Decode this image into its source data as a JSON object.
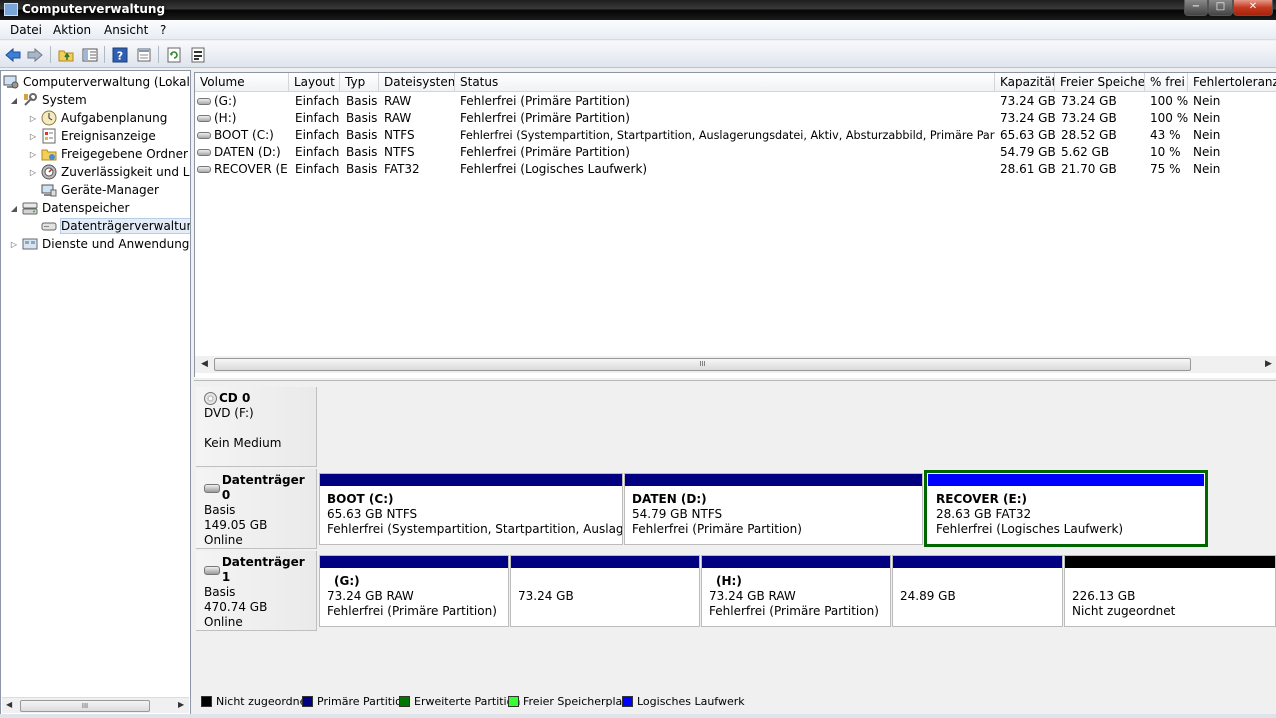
{
  "window": {
    "title": "Computerverwaltung",
    "min": "−",
    "max": "□",
    "close": "✕"
  },
  "menu": [
    "Datei",
    "Aktion",
    "Ansicht",
    "?"
  ],
  "tree": {
    "root": "Computerverwaltung (Lokal)",
    "system": "System",
    "aufgaben": "Aufgabenplanung",
    "ereignis": "Ereignisanzeige",
    "freigabe": "Freigegebene Ordner",
    "zuverl": "Zuverlässigkeit und Leis",
    "geraete": "Geräte-Manager",
    "datenspeicher": "Datenspeicher",
    "dtv": "Datenträgerverwaltung",
    "dienste": "Dienste und Anwendungen",
    "scroll_grip": "III"
  },
  "columns": [
    "Volume",
    "Layout",
    "Typ",
    "Dateisystem",
    "Status",
    "Kapazität",
    "Freier Speicher",
    "% frei",
    "Fehlertoleranz"
  ],
  "volumes": [
    {
      "volume": "(G:)",
      "layout": "Einfach",
      "typ": "Basis",
      "fs": "RAW",
      "status": "Fehlerfrei (Primäre Partition)",
      "cap": "73.24 GB",
      "free": "73.24 GB",
      "pct": "100 %",
      "ft": "Nein"
    },
    {
      "volume": "(H:)",
      "layout": "Einfach",
      "typ": "Basis",
      "fs": "RAW",
      "status": "Fehlerfrei (Primäre Partition)",
      "cap": "73.24 GB",
      "free": "73.24 GB",
      "pct": "100 %",
      "ft": "Nein"
    },
    {
      "volume": "BOOT (C:)",
      "layout": "Einfach",
      "typ": "Basis",
      "fs": "NTFS",
      "status": "Fehlerfrei (Systempartition, Startpartition, Auslagerungsdatei, Aktiv, Absturzabbild, Primäre Partition)",
      "cap": "65.63 GB",
      "free": "28.52 GB",
      "pct": "43 %",
      "ft": "Nein"
    },
    {
      "volume": "DATEN (D:)",
      "layout": "Einfach",
      "typ": "Basis",
      "fs": "NTFS",
      "status": "Fehlerfrei (Primäre Partition)",
      "cap": "54.79 GB",
      "free": "5.62 GB",
      "pct": "10 %",
      "ft": "Nein"
    },
    {
      "volume": "RECOVER (E:)",
      "layout": "Einfach",
      "typ": "Basis",
      "fs": "FAT32",
      "status": "Fehlerfrei (Logisches Laufwerk)",
      "cap": "28.61 GB",
      "free": "21.70 GB",
      "pct": "75 %",
      "ft": "Nein"
    }
  ],
  "list_scroll_grip": "III",
  "disks": {
    "cd0": {
      "name": "CD 0",
      "l1": "DVD (F:)",
      "l2": "",
      "l3": "Kein Medium"
    },
    "d0": {
      "name": "Datenträger 0",
      "l1": "Basis",
      "l2": "149.05 GB",
      "l3": "Online",
      "parts": [
        {
          "title": "BOOT  (C:)",
          "size": "65.63 GB NTFS",
          "status": "Fehlerfrei (Systempartition, Startpartition, Auslagerungsdatei"
        },
        {
          "title": "DATEN  (D:)",
          "size": "54.79 GB NTFS",
          "status": "Fehlerfrei (Primäre Partition)"
        },
        {
          "title": "RECOVER  (E:)",
          "size": "28.63 GB FAT32",
          "status": "Fehlerfrei (Logisches Laufwerk)"
        }
      ]
    },
    "d1": {
      "name": "Datenträger 1",
      "l1": "Basis",
      "l2": "470.74 GB",
      "l3": "Online",
      "parts": [
        {
          "title": "(G:)",
          "size": "73.24 GB RAW",
          "status": "Fehlerfrei (Primäre Partition)"
        },
        {
          "title": "",
          "size": "73.24 GB",
          "status": ""
        },
        {
          "title": "(H:)",
          "size": "73.24 GB RAW",
          "status": "Fehlerfrei (Primäre Partition)"
        },
        {
          "title": "",
          "size": "24.89 GB",
          "status": ""
        },
        {
          "title": "",
          "size": "226.13 GB",
          "status": "Nicht zugeordnet"
        }
      ]
    }
  },
  "legend": [
    {
      "label": "Nicht zugeordnet",
      "color": "#000000"
    },
    {
      "label": "Primäre Partition",
      "color": "#000080"
    },
    {
      "label": "Erweiterte Partition",
      "color": "#007700"
    },
    {
      "label": "Freier Speicherplatz",
      "color": "#33ff33"
    },
    {
      "label": "Logisches Laufwerk",
      "color": "#0000ff"
    }
  ],
  "colors": {
    "primary": "#000080",
    "logical": "#0000ff",
    "unallocated": "#000000",
    "selected_border": "#006600"
  }
}
